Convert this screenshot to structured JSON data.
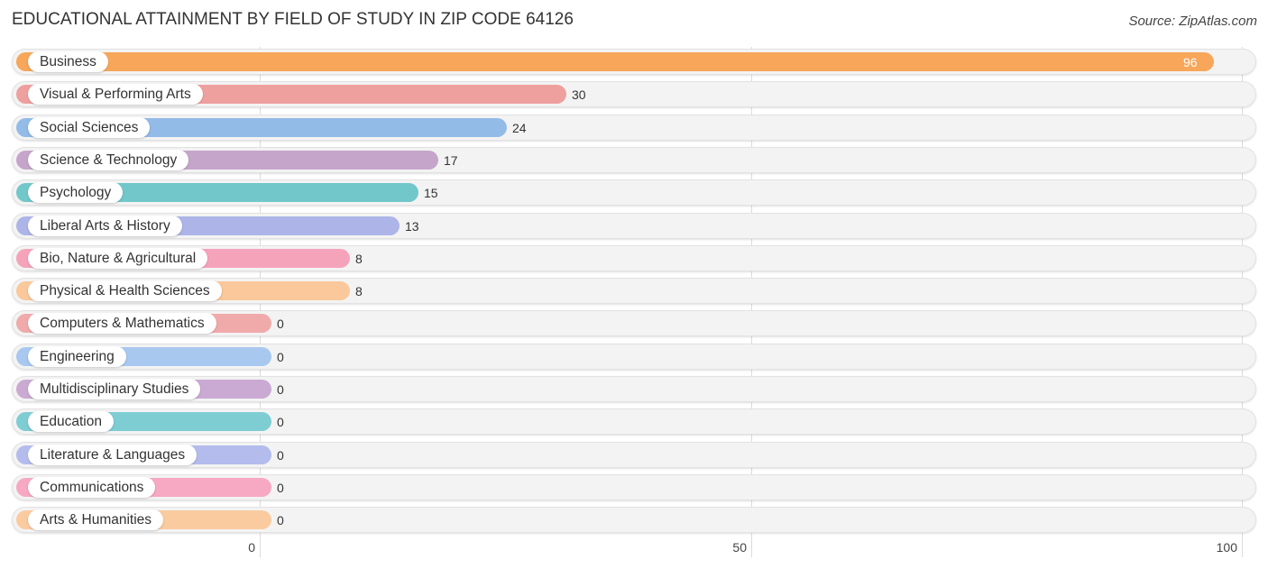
{
  "chart_data": {
    "type": "bar",
    "orientation": "horizontal",
    "title": "EDUCATIONAL ATTAINMENT BY FIELD OF STUDY IN ZIP CODE 64126",
    "source": "Source: ZipAtlas.com",
    "xlabel": "",
    "ylabel": "",
    "xlim": [
      0,
      100
    ],
    "xticks": [
      "0",
      "50",
      "100"
    ],
    "grid": true,
    "categories": [
      "Business",
      "Visual & Performing Arts",
      "Social Sciences",
      "Science & Technology",
      "Psychology",
      "Liberal Arts & History",
      "Bio, Nature & Agricultural",
      "Physical & Health Sciences",
      "Computers & Mathematics",
      "Engineering",
      "Multidisciplinary Studies",
      "Education",
      "Literature & Languages",
      "Communications",
      "Arts & Humanities"
    ],
    "values": [
      96,
      30,
      24,
      17,
      15,
      13,
      8,
      8,
      0,
      0,
      0,
      0,
      0,
      0,
      0
    ],
    "value_labels": [
      "96",
      "30",
      "24",
      "17",
      "15",
      "13",
      "8",
      "8",
      "0",
      "0",
      "0",
      "0",
      "0",
      "0",
      "0"
    ],
    "colors": [
      "#f7a65a",
      "#eea09e",
      "#93bbe8",
      "#c6a5cb",
      "#72c7cb",
      "#adb5e8",
      "#f5a3bb",
      "#fac89a",
      "#f1aaaa",
      "#a8c8ef",
      "#caaad3",
      "#7ecdd3",
      "#b3bcec",
      "#f7a8c3",
      "#facb9f"
    ]
  }
}
